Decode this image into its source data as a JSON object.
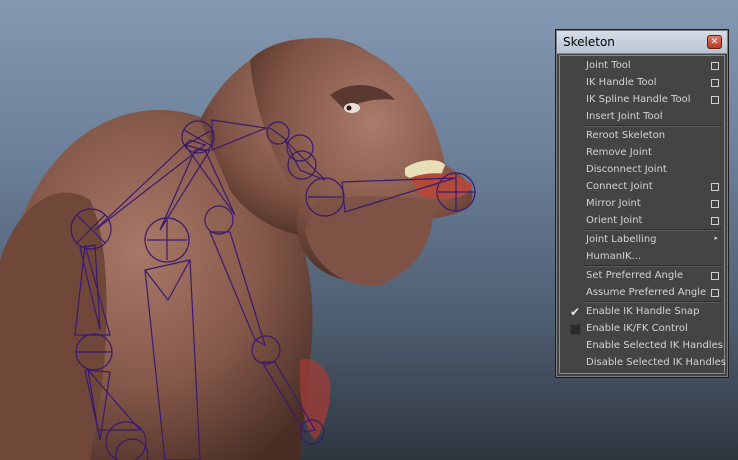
{
  "window": {
    "title": "Skeleton",
    "close_glyph": "✕"
  },
  "menu": {
    "items": [
      {
        "label": "Joint Tool",
        "option_box": true
      },
      {
        "label": "IK Handle Tool",
        "option_box": true
      },
      {
        "label": "IK Spline Handle Tool",
        "option_box": true
      },
      {
        "label": "Insert Joint Tool",
        "option_box": false
      },
      {
        "label": "Reroot Skeleton",
        "option_box": false
      },
      {
        "label": "Remove Joint",
        "option_box": false
      },
      {
        "label": "Disconnect Joint",
        "option_box": false
      },
      {
        "label": "Connect Joint",
        "option_box": true
      },
      {
        "label": "Mirror Joint",
        "option_box": true
      },
      {
        "label": "Orient Joint",
        "option_box": true
      },
      {
        "label": "Joint Labelling",
        "submenu": true
      },
      {
        "label": "HumanIK...",
        "option_box": false
      },
      {
        "label": "Set Preferred Angle",
        "option_box": true
      },
      {
        "label": "Assume Preferred Angle",
        "option_box": true
      },
      {
        "label": "Enable IK Handle Snap",
        "checked": true
      },
      {
        "label": "Enable IK/FK Control",
        "checked": false
      },
      {
        "label": "Enable Selected IK Handles",
        "option_box": false
      },
      {
        "label": "Disable Selected IK Handles",
        "option_box": false
      }
    ]
  },
  "colors": {
    "skeleton_wire": "#3a1a6e",
    "skin": "#8a5c4c",
    "menu_bg": "#444444",
    "menu_text": "#d4d4d4"
  }
}
